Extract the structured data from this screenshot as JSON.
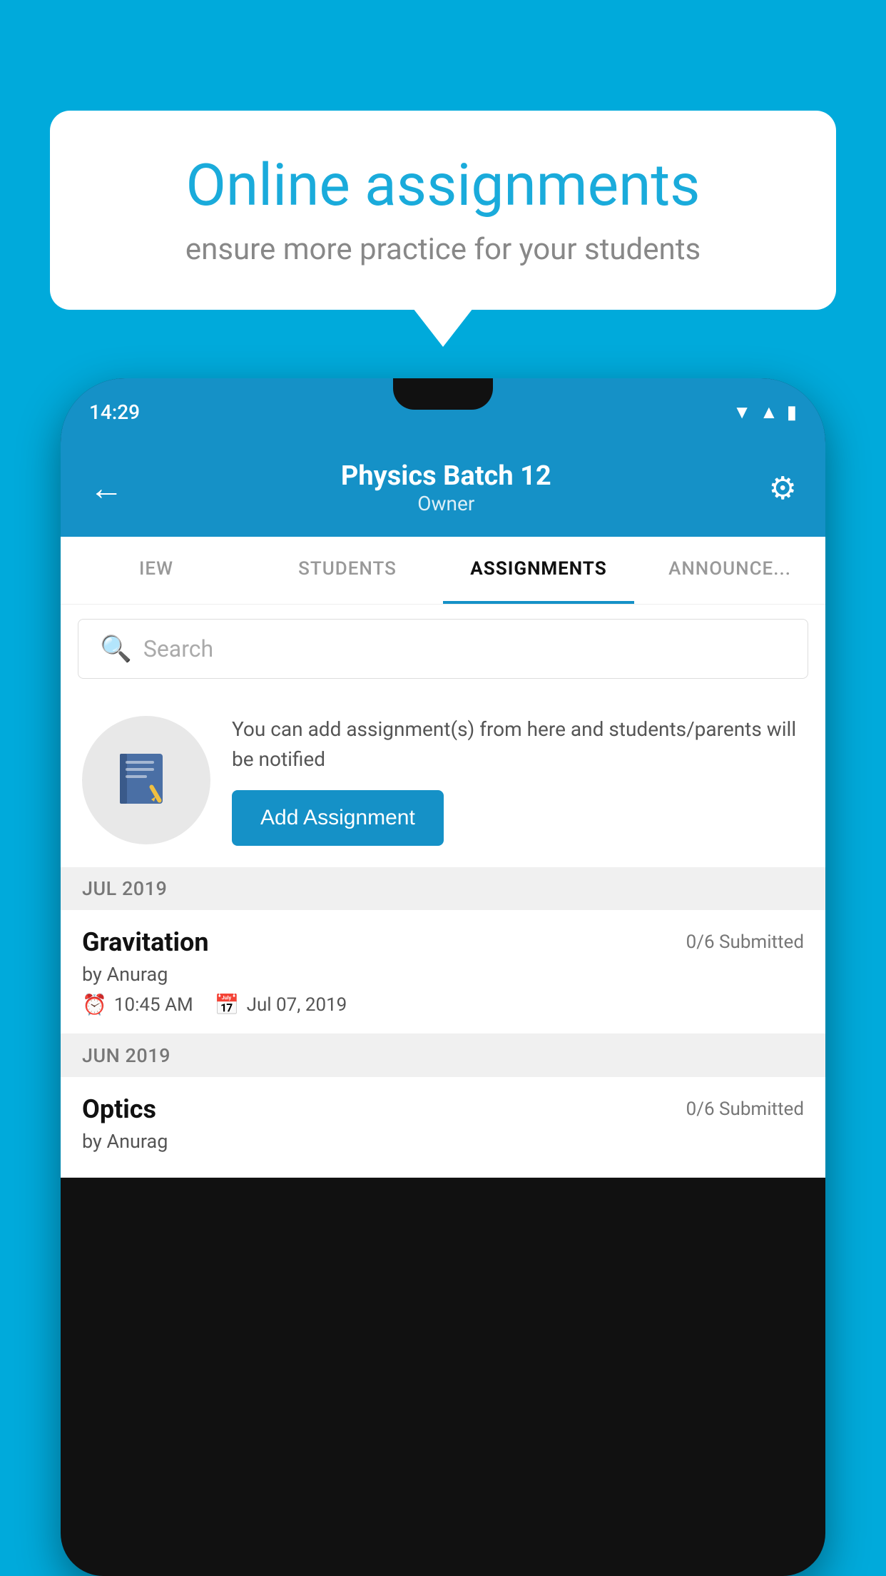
{
  "background_color": "#00AADB",
  "bubble": {
    "title": "Online assignments",
    "subtitle": "ensure more practice for your students"
  },
  "phone": {
    "status_time": "14:29",
    "header": {
      "title": "Physics Batch 12",
      "subtitle": "Owner"
    },
    "tabs": [
      {
        "label": "IEW",
        "active": false
      },
      {
        "label": "STUDENTS",
        "active": false
      },
      {
        "label": "ASSIGNMENTS",
        "active": true
      },
      {
        "label": "ANNOUNCEMENTS",
        "active": false
      }
    ],
    "search": {
      "placeholder": "Search"
    },
    "info_text": "You can add assignment(s) from here and students/parents will be notified",
    "add_assignment_label": "Add Assignment",
    "sections": [
      {
        "month": "JUL 2019",
        "assignments": [
          {
            "name": "Gravitation",
            "submitted": "0/6 Submitted",
            "by": "by Anurag",
            "time": "10:45 AM",
            "date": "Jul 07, 2019"
          }
        ]
      },
      {
        "month": "JUN 2019",
        "assignments": [
          {
            "name": "Optics",
            "submitted": "0/6 Submitted",
            "by": "by Anurag",
            "time": "",
            "date": ""
          }
        ]
      }
    ]
  }
}
